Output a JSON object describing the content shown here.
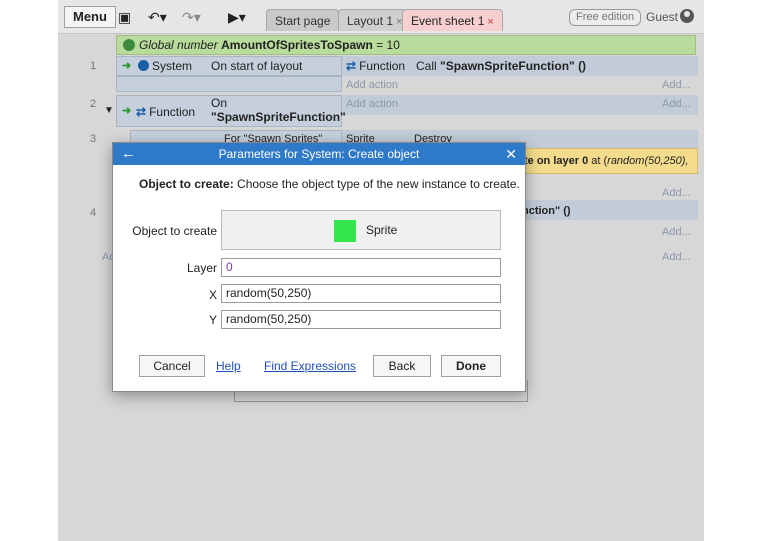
{
  "toolbar": {
    "menu_label": "Menu",
    "tabs": [
      {
        "label": "Start page"
      },
      {
        "label": "Layout 1"
      },
      {
        "label": "Event sheet 1"
      }
    ],
    "close_glyph": "×",
    "edition_label": "Free edition",
    "user_label": "Guest"
  },
  "event_sheet": {
    "global_var": {
      "prefix": "Global number",
      "name": "AmountOfSpritesToSpawn",
      "suffix": "= 10"
    },
    "row_numbers": [
      "1",
      "2",
      "3",
      "4"
    ],
    "events": [
      {
        "object": "System",
        "condition": "On start of layout",
        "action_object": "Function",
        "action_prefix": "Call",
        "action_text": "\"SpawnSpriteFunction\" ()"
      },
      {
        "object": "Function",
        "condition_line1": "On",
        "condition_line2": "\"SpawnSpriteFunction\""
      }
    ],
    "add_action": "Add action",
    "add_more": "Add...",
    "add_short": "Ad",
    "partial_texts": {
      "for_spawn": "For \"Spawn Sprites\"",
      "sprite": "Sprite",
      "destroy": "Destroy",
      "layer_text_prefix": "te on layer ",
      "layer_value": "0",
      "layer_text_at": " at (",
      "layer_text_expr": "random(50,250),",
      "function_call": "nction\" ()"
    }
  },
  "dialog": {
    "title": "Parameters for System: Create object",
    "description_bold": "Object to create:",
    "description_text": "Choose the object type of the new instance to create.",
    "params": {
      "object_label": "Object to create",
      "object_value": "Sprite",
      "layer_label": "Layer",
      "layer_value": "0",
      "x_label": "X",
      "x_value": "random(50,250)",
      "y_label": "Y",
      "y_value": "random(50,250)"
    },
    "buttons": {
      "cancel": "Cancel",
      "help": "Help",
      "find_expressions": "Find Expressions",
      "back": "Back",
      "done": "Done"
    },
    "colors": {
      "title_bar": "#2e79c8",
      "sprite_swatch": "#33e64c"
    }
  }
}
